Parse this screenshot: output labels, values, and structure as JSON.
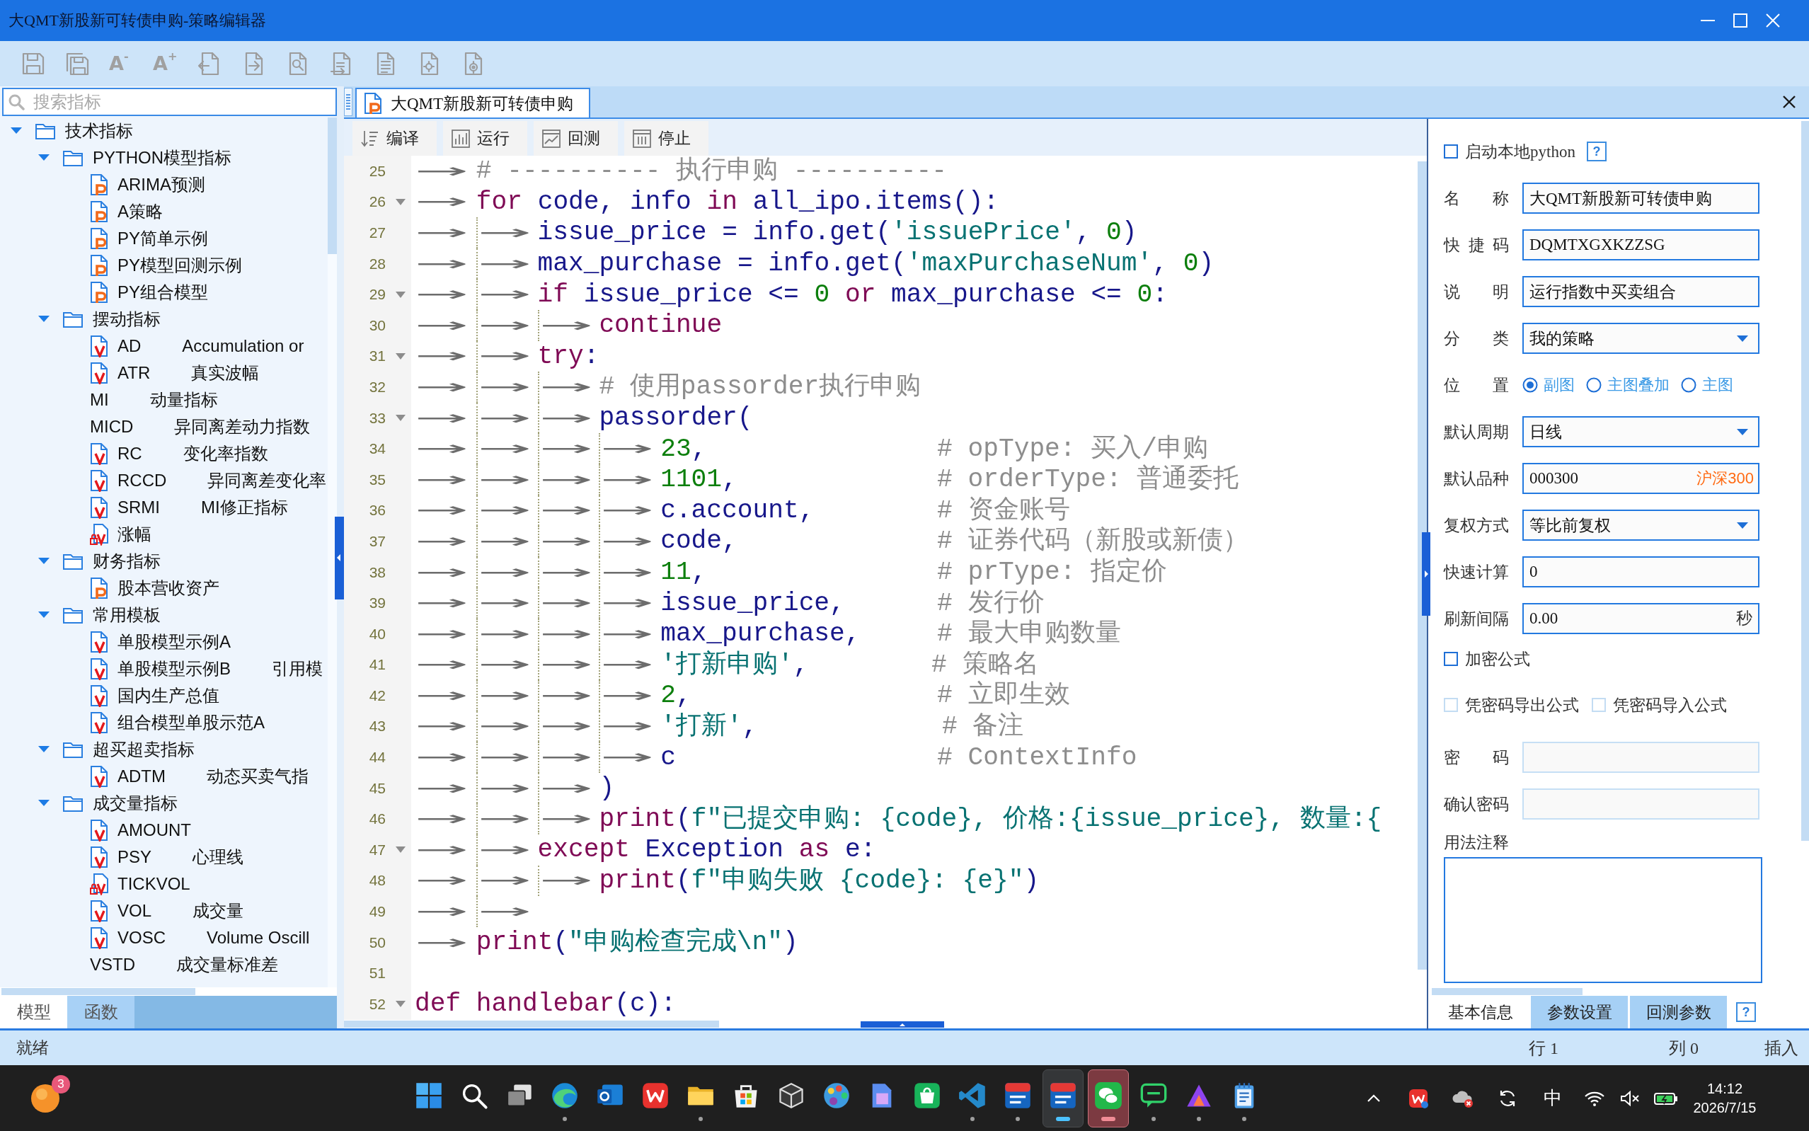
{
  "window": {
    "title": "大QMT新股新可转债申购-策略编辑器"
  },
  "toolbar": [
    {
      "kind": "save"
    },
    {
      "kind": "save-all"
    },
    {
      "kind": "font-smaller",
      "label": "A$^{-}$"
    },
    {
      "kind": "font-larger",
      "label": "A$^{+}$"
    },
    {
      "kind": "import"
    },
    {
      "kind": "export"
    },
    {
      "kind": "find"
    },
    {
      "kind": "doc-arrow"
    },
    {
      "kind": "doc-list"
    },
    {
      "kind": "doc-gear"
    },
    {
      "kind": "doc-cog"
    }
  ],
  "sidebar": {
    "search": {
      "placeholder": "搜索指标"
    },
    "tree": [
      {
        "kind": "folder",
        "label": "技术指标",
        "expanded": true,
        "children": [
          {
            "kind": "folder",
            "label": "PYTHON模型指标",
            "expanded": true,
            "children": [
              {
                "kind": "python",
                "label": "ARIMA预测"
              },
              {
                "kind": "python",
                "label": "A策略"
              },
              {
                "kind": "python",
                "label": "PY简单示例"
              },
              {
                "kind": "python",
                "label": "PY模型回测示例"
              },
              {
                "kind": "python",
                "label": "PY组合模型"
              }
            ]
          },
          {
            "kind": "folder",
            "label": "摆动指标",
            "expanded": true,
            "children": [
              {
                "kind": "formula",
                "label": "AD",
                "description": "Accumulation or"
              },
              {
                "kind": "formula",
                "label": "ATR",
                "description": "真实波幅"
              },
              {
                "kind": "plain",
                "label": "MI",
                "description": "动量指标"
              },
              {
                "kind": "plain",
                "label": "MICD",
                "description": "异同离差动力指数"
              },
              {
                "kind": "formula",
                "label": "RC",
                "description": "变化率指数"
              },
              {
                "kind": "formula",
                "label": "RCCD",
                "description": "异同离差变化率"
              },
              {
                "kind": "formula",
                "label": "SRMI",
                "description": "MI修正指标"
              },
              {
                "kind": "locked",
                "label": "涨幅"
              }
            ]
          },
          {
            "kind": "folder",
            "label": "财务指标",
            "expanded": true,
            "children": [
              {
                "kind": "python",
                "label": "股本营收资产"
              }
            ]
          },
          {
            "kind": "folder",
            "label": "常用模板",
            "expanded": true,
            "children": [
              {
                "kind": "formula",
                "label": "单股模型示例A"
              },
              {
                "kind": "formula",
                "label": "单股模型示例B",
                "description": "引用模"
              },
              {
                "kind": "formula",
                "label": "国内生产总值"
              },
              {
                "kind": "formula",
                "label": "组合模型单股示范A"
              }
            ]
          },
          {
            "kind": "folder",
            "label": "超买超卖指标",
            "expanded": true,
            "children": [
              {
                "kind": "formula",
                "label": "ADTM",
                "description": "动态买卖气指"
              }
            ]
          },
          {
            "kind": "folder",
            "label": "成交量指标",
            "expanded": true,
            "children": [
              {
                "kind": "formula",
                "label": "AMOUNT"
              },
              {
                "kind": "formula",
                "label": "PSY",
                "description": "心理线"
              },
              {
                "kind": "locked",
                "label": "TICKVOL"
              },
              {
                "kind": "formula",
                "label": "VOL",
                "description": "成交量"
              },
              {
                "kind": "formula",
                "label": "VOSC",
                "description": "Volume Oscill"
              },
              {
                "kind": "plain",
                "label": "VSTD",
                "description": "成交量标准差"
              }
            ]
          }
        ]
      }
    ],
    "tabs": [
      {
        "label": "模型",
        "selected": true
      },
      {
        "label": "函数",
        "selected": false
      }
    ]
  },
  "editor": {
    "tabs": [
      {
        "label": "大QMT新股新可转债申购",
        "kind": "python",
        "selected": true
      }
    ],
    "actions": [
      {
        "kind": "compile",
        "label": "编译"
      },
      {
        "kind": "run",
        "label": "运行"
      },
      {
        "kind": "backtest",
        "label": "回测"
      },
      {
        "kind": "stop",
        "label": "停止"
      }
    ],
    "lines": [
      {
        "number": "25",
        "foldable": false,
        "indent": "→",
        "tokens": [
          {
            "kind": "comment",
            "text": "# ---------- 执行申购 ----------"
          }
        ]
      },
      {
        "number": "26",
        "foldable": true,
        "indent": "→",
        "tokens": [
          {
            "kind": "keyword",
            "text": "for"
          },
          {
            "kind": "name",
            "text": " code, info "
          },
          {
            "kind": "keyword",
            "text": "in"
          },
          {
            "kind": "name",
            "text": " all_ipo.items():"
          }
        ]
      },
      {
        "number": "27",
        "foldable": false,
        "indent": "→ →",
        "tokens": [
          {
            "kind": "name",
            "text": "issue_price = info.get("
          },
          {
            "kind": "string",
            "text": "'issuePrice'"
          },
          {
            "kind": "name",
            "text": ", "
          },
          {
            "kind": "number",
            "text": "0"
          },
          {
            "kind": "name",
            "text": ")"
          }
        ]
      },
      {
        "number": "28",
        "foldable": false,
        "indent": "→ →",
        "tokens": [
          {
            "kind": "name",
            "text": "max_purchase = info.get("
          },
          {
            "kind": "string",
            "text": "'maxPurchaseNum'"
          },
          {
            "kind": "name",
            "text": ", "
          },
          {
            "kind": "number",
            "text": "0"
          },
          {
            "kind": "name",
            "text": ")"
          }
        ]
      },
      {
        "number": "29",
        "foldable": true,
        "indent": "→ →",
        "tokens": [
          {
            "kind": "keyword",
            "text": "if"
          },
          {
            "kind": "name",
            "text": " issue_price <= "
          },
          {
            "kind": "number",
            "text": "0"
          },
          {
            "kind": "keyword",
            "text": " or"
          },
          {
            "kind": "name",
            "text": " max_purchase <= "
          },
          {
            "kind": "number",
            "text": "0"
          },
          {
            "kind": "name",
            "text": ":"
          }
        ]
      },
      {
        "number": "30",
        "foldable": false,
        "indent": "→ → →",
        "tokens": [
          {
            "kind": "keyword",
            "text": "continue"
          }
        ]
      },
      {
        "number": "31",
        "foldable": true,
        "indent": "→ →",
        "tokens": [
          {
            "kind": "keyword",
            "text": "try"
          },
          {
            "kind": "name",
            "text": ":"
          }
        ]
      },
      {
        "number": "32",
        "foldable": false,
        "indent": "→ → →",
        "tokens": [
          {
            "kind": "comment",
            "text": "# 使用passorder执行申购"
          }
        ]
      },
      {
        "number": "33",
        "foldable": true,
        "indent": "→ → →",
        "tokens": [
          {
            "kind": "name",
            "text": "passorder("
          }
        ]
      },
      {
        "number": "34",
        "foldable": false,
        "indent": "→ → → →",
        "tokens": [
          {
            "kind": "number",
            "text": "23"
          },
          {
            "kind": "name",
            "text": ","
          },
          {
            "kind": "comment",
            "text": "               # opType: 买入/申购"
          }
        ]
      },
      {
        "number": "35",
        "foldable": false,
        "indent": "→ → → →",
        "tokens": [
          {
            "kind": "number",
            "text": "1101"
          },
          {
            "kind": "name",
            "text": ","
          },
          {
            "kind": "comment",
            "text": "             # orderType: 普通委托"
          }
        ]
      },
      {
        "number": "36",
        "foldable": false,
        "indent": "→ → → →",
        "tokens": [
          {
            "kind": "name",
            "text": "c.account,"
          },
          {
            "kind": "comment",
            "text": "        # 资金账号"
          }
        ]
      },
      {
        "number": "37",
        "foldable": false,
        "indent": "→ → → →",
        "tokens": [
          {
            "kind": "name",
            "text": "code,"
          },
          {
            "kind": "comment",
            "text": "             # 证券代码（新股或新债）"
          }
        ]
      },
      {
        "number": "38",
        "foldable": false,
        "indent": "→ → → →",
        "tokens": [
          {
            "kind": "number",
            "text": "11"
          },
          {
            "kind": "name",
            "text": ","
          },
          {
            "kind": "comment",
            "text": "               # prType: 指定价"
          }
        ]
      },
      {
        "number": "39",
        "foldable": false,
        "indent": "→ → → →",
        "tokens": [
          {
            "kind": "name",
            "text": "issue_price,"
          },
          {
            "kind": "comment",
            "text": "      # 发行价"
          }
        ]
      },
      {
        "number": "40",
        "foldable": false,
        "indent": "→ → → →",
        "tokens": [
          {
            "kind": "name",
            "text": "max_purchase,"
          },
          {
            "kind": "comment",
            "text": "     # 最大申购数量"
          }
        ]
      },
      {
        "number": "41",
        "foldable": false,
        "indent": "→ → → →",
        "tokens": [
          {
            "kind": "string",
            "text": "'打新申购'"
          },
          {
            "kind": "name",
            "text": ","
          },
          {
            "kind": "comment",
            "text": "        # 策略名"
          }
        ]
      },
      {
        "number": "42",
        "foldable": false,
        "indent": "→ → → →",
        "tokens": [
          {
            "kind": "number",
            "text": "2"
          },
          {
            "kind": "name",
            "text": ","
          },
          {
            "kind": "comment",
            "text": "                # 立即生效"
          }
        ]
      },
      {
        "number": "43",
        "foldable": false,
        "indent": "→ → → →",
        "tokens": [
          {
            "kind": "string",
            "text": "'打新'"
          },
          {
            "kind": "name",
            "text": ","
          },
          {
            "kind": "comment",
            "text": "            # 备注"
          }
        ]
      },
      {
        "number": "44",
        "foldable": false,
        "indent": "→ → → →",
        "tokens": [
          {
            "kind": "name",
            "text": "c"
          },
          {
            "kind": "comment",
            "text": "                 # ContextInfo"
          }
        ]
      },
      {
        "number": "45",
        "foldable": false,
        "indent": "→ → →",
        "tokens": [
          {
            "kind": "name",
            "text": ")"
          }
        ]
      },
      {
        "number": "46",
        "foldable": false,
        "indent": "→ → →",
        "tokens": [
          {
            "kind": "keyword",
            "text": "print"
          },
          {
            "kind": "name",
            "text": "("
          },
          {
            "kind": "string",
            "text": "f\"已提交申购: {code}, 价格:{issue_price}, 数量:{"
          }
        ]
      },
      {
        "number": "47",
        "foldable": true,
        "indent": "→ →",
        "tokens": [
          {
            "kind": "keyword",
            "text": "except"
          },
          {
            "kind": "name",
            "text": " Exception "
          },
          {
            "kind": "keyword",
            "text": "as"
          },
          {
            "kind": "name",
            "text": " e:"
          }
        ]
      },
      {
        "number": "48",
        "foldable": false,
        "indent": "→ → →",
        "tokens": [
          {
            "kind": "keyword",
            "text": "print"
          },
          {
            "kind": "name",
            "text": "("
          },
          {
            "kind": "string",
            "text": "f\"申购失败 {code}: {e}\""
          },
          {
            "kind": "name",
            "text": ")"
          }
        ]
      },
      {
        "number": "49",
        "foldable": false,
        "indent": "→ →"
      },
      {
        "number": "50",
        "foldable": false,
        "indent": "→",
        "tokens": [
          {
            "kind": "keyword",
            "text": "print"
          },
          {
            "kind": "name",
            "text": "("
          },
          {
            "kind": "string",
            "text": "\"申购检查完成\\n\""
          },
          {
            "kind": "name",
            "text": ")"
          }
        ]
      },
      {
        "number": "51",
        "foldable": false
      },
      {
        "number": "52",
        "foldable": true,
        "tokens": [
          {
            "kind": "keyword",
            "text": "def handlebar"
          },
          {
            "kind": "name",
            "text": "(c):"
          }
        ]
      }
    ]
  },
  "properties": {
    "local_python": {
      "label": "启动本地python",
      "checked": false,
      "disabled": false
    },
    "help": "?",
    "fields": [
      {
        "kind": "text",
        "label": "名 称",
        "value": "大QMT新股新可转债申购",
        "disabled": false
      },
      {
        "kind": "text",
        "label": "快 捷 码",
        "value": "DQMTXGXKZZSG",
        "disabled": false
      },
      {
        "kind": "text",
        "label": "说 明",
        "value": "运行指数中买卖组合",
        "disabled": false
      },
      {
        "kind": "select",
        "label": "分 类",
        "value": "我的策略",
        "disabled": false
      },
      {
        "kind": "radio",
        "label": "位 置",
        "disabled": false,
        "options": [
          {
            "label": "副图",
            "selected": true
          },
          {
            "label": "主图叠加",
            "selected": false
          },
          {
            "label": "主图",
            "selected": false
          }
        ]
      },
      {
        "kind": "select",
        "label": "默认周期",
        "value": "日线",
        "disabled": false
      },
      {
        "kind": "text",
        "label": "默认品种",
        "value": "000300",
        "hint": "沪深300",
        "disabled": false
      },
      {
        "kind": "select",
        "label": "复权方式",
        "value": "等比前复权",
        "disabled": false
      },
      {
        "kind": "text",
        "label": "快速计算",
        "value": "0",
        "disabled": false
      },
      {
        "kind": "text",
        "label": "刷新间隔",
        "value": "0.00",
        "unit": "秒",
        "disabled": false
      },
      {
        "kind": "checkbox",
        "label": "加密公式",
        "checked": false,
        "disabled": false
      },
      {
        "kind": "checkbox-pair",
        "disabled": true,
        "items": [
          {
            "label": "凭密码导出公式",
            "checked": false
          },
          {
            "label": "凭密码导入公式",
            "checked": false
          }
        ]
      },
      {
        "kind": "text",
        "label": "密 码",
        "disabled": true
      },
      {
        "kind": "text",
        "label": "确认密码",
        "disabled": true
      },
      {
        "kind": "textarea",
        "label": "用法注释",
        "disabled": false
      }
    ],
    "tabs": [
      {
        "label": "基本信息",
        "selected": true
      },
      {
        "label": "参数设置",
        "selected": false
      },
      {
        "label": "回测参数",
        "selected": false
      }
    ],
    "tabs_help": "?"
  },
  "status_bar": {
    "message": "就绪",
    "line": "行 1",
    "column": "列 0",
    "mode": "插入"
  },
  "taskbar": {
    "badge": "3",
    "apps": [
      {
        "kind": "start",
        "running": false,
        "focused": false,
        "flashing": false
      },
      {
        "kind": "search",
        "running": false,
        "focused": false,
        "flashing": false
      },
      {
        "kind": "task-view",
        "running": false,
        "focused": false,
        "flashing": false
      },
      {
        "kind": "browser",
        "running": true,
        "focused": false,
        "flashing": false
      },
      {
        "kind": "mail",
        "running": false,
        "focused": false,
        "flashing": false
      },
      {
        "kind": "office",
        "running": false,
        "focused": false,
        "flashing": false
      },
      {
        "kind": "folder",
        "running": true,
        "focused": false,
        "flashing": false
      },
      {
        "kind": "store",
        "running": false,
        "focused": false,
        "flashing": false
      },
      {
        "kind": "cube",
        "running": false,
        "focused": false,
        "flashing": false
      },
      {
        "kind": "palette",
        "running": false,
        "focused": false,
        "flashing": false
      },
      {
        "kind": "document",
        "running": false,
        "focused": false,
        "flashing": false
      },
      {
        "kind": "bag",
        "running": false,
        "focused": false,
        "flashing": false
      },
      {
        "kind": "code-editor",
        "running": true,
        "focused": false,
        "flashing": false
      },
      {
        "kind": "trading",
        "running": true,
        "focused": false,
        "flashing": false
      },
      {
        "kind": "trading",
        "running": true,
        "focused": true,
        "flashing": false
      },
      {
        "kind": "chat",
        "running": true,
        "focused": false,
        "flashing": true
      },
      {
        "kind": "message",
        "running": true,
        "focused": false,
        "flashing": false
      },
      {
        "kind": "triangle",
        "running": true,
        "focused": false,
        "flashing": false
      },
      {
        "kind": "notepad",
        "running": true,
        "focused": false,
        "flashing": false
      }
    ],
    "tray": [
      {
        "kind": "chevron"
      },
      {
        "kind": "office"
      },
      {
        "kind": "cloud-error"
      },
      {
        "kind": "sync"
      },
      {
        "kind": "ime",
        "label": "中"
      },
      {
        "kind": "wifi"
      },
      {
        "kind": "mute"
      },
      {
        "kind": "battery"
      }
    ],
    "time": "14:12",
    "date": "2026/7/15"
  }
}
